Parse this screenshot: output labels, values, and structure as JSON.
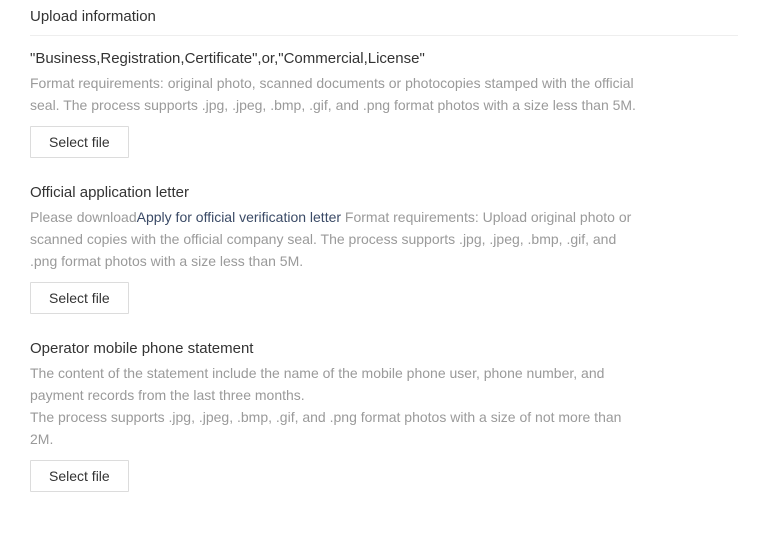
{
  "header": "Upload information",
  "section1": {
    "title": "\"Business,Registration,Certificate\",or,\"Commercial,License\"",
    "desc": "Format requirements: original photo, scanned documents or photocopies stamped with the official seal. The process supports .jpg, .jpeg, .bmp, .gif, and .png format photos with a size less than 5M.",
    "button": "Select file"
  },
  "section2": {
    "title": "Official application letter",
    "desc_prefix": "Please download",
    "link_text": "Apply for official verification letter",
    "desc_suffix": " Format requirements: Upload original photo or scanned copies with the official company seal. The process supports .jpg, .jpeg, .bmp, .gif, and .png format photos with a size less than 5M.",
    "button": "Select file"
  },
  "section3": {
    "title": "Operator mobile phone statement",
    "desc_line1": "The content of the statement include the name of the mobile phone user, phone number, and payment records from the last three months.",
    "desc_line2": "The process supports .jpg, .jpeg, .bmp, .gif, and .png format photos with a size of not more than 2M.",
    "button": "Select file"
  }
}
